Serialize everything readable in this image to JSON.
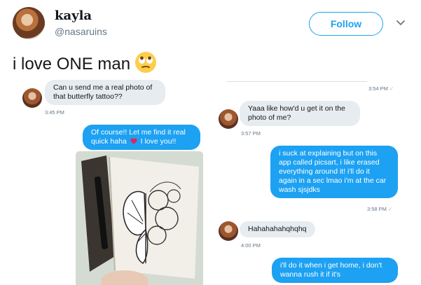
{
  "tweet": {
    "display_name": "kayla",
    "handle": "@nasaruins",
    "follow_label": "Follow",
    "text": "i love ONE man",
    "emoji": "face-with-rolling-eyes"
  },
  "conversation": {
    "top_right_time": "3:54 PM",
    "messages": [
      {
        "side": "left",
        "text": "Can u send me a real photo of that butterfly tattoo??",
        "time": "3:45 PM"
      },
      {
        "side": "right",
        "text": "Of course!! Let me find it real quick haha",
        "text_after_heart": "I love you!!"
      },
      {
        "side": "left",
        "text": "Yaaa like how'd u get it on the photo of me?",
        "time": "3:57 PM"
      },
      {
        "side": "right",
        "text": "i suck at explaining but on this app called picsart, i like erased everything around it! i'll do it again in a sec lmao i'm at the car wash sjsjdks",
        "time": "3:58 PM"
      },
      {
        "side": "left",
        "text": "Hahahahahqhqhq",
        "time": "4:00 PM"
      },
      {
        "side": "right",
        "text": "i'll do it when i get home, i don't wanna rush it if it's"
      }
    ]
  },
  "colors": {
    "accent": "#1da1f2",
    "bubble_gray": "#e6ecf0",
    "text_secondary": "#657786",
    "heart": "#e0245e"
  },
  "icons": {
    "chevron": "chevron-down-icon",
    "heart": "heart-icon",
    "read_check": "check-icon"
  }
}
